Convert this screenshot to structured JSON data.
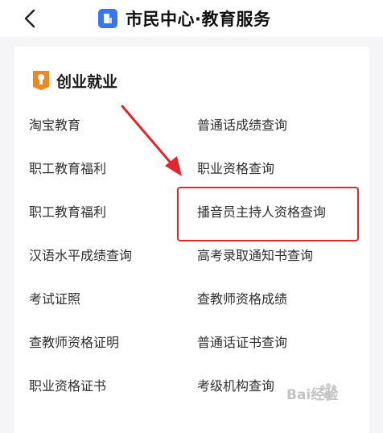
{
  "header": {
    "title": "市民中心·教育服务"
  },
  "section": {
    "title": "创业就业"
  },
  "links_left": [
    "淘宝教育",
    "职工教育福利",
    "职工教育福利",
    "汉语水平成绩查询",
    "考试证照",
    "查教师资格证明",
    "职业资格证书"
  ],
  "links_right": [
    "普通话成绩查询",
    "职业资格查询",
    "播音员主持人资格查询",
    "高考录取通知书查询",
    "查教师资格成绩",
    "普通话证书查询",
    "考级机构查询"
  ],
  "watermark": {
    "text": "Bai经验"
  },
  "colors": {
    "accent": "#3a73f6",
    "section_icon": "#f0871f",
    "highlight": "#e3262b",
    "background": "#f5f5f7"
  }
}
